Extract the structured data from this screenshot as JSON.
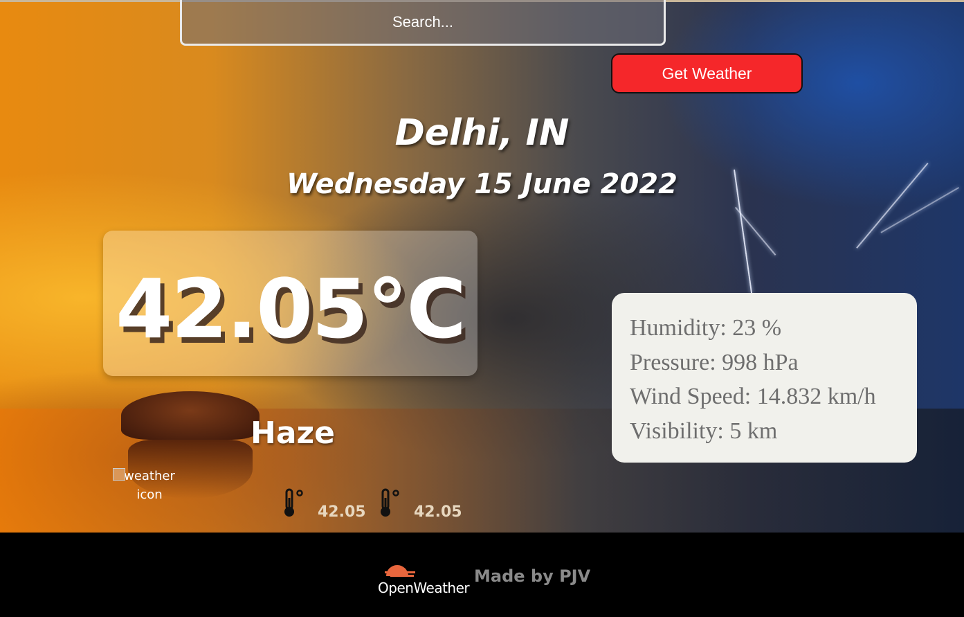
{
  "search": {
    "placeholder": "Search..."
  },
  "actions": {
    "get_weather_label": "Get Weather"
  },
  "location": {
    "city": "Delhi, IN",
    "date": "Wednesday 15 June 2022"
  },
  "current": {
    "temperature": "42.05°C",
    "condition": "Haze",
    "icon_alt": "weather icon"
  },
  "min_max": [
    {
      "icon": "thermometer-icon",
      "value": "42.05"
    },
    {
      "icon": "thermometer-icon",
      "value": "42.05"
    }
  ],
  "details": {
    "humidity": "Humidity: 23 %",
    "pressure": "Pressure: 998 hPa",
    "wind": "Wind Speed: 14.832 km/h",
    "visibility": "Visibility: 5 km"
  },
  "footer": {
    "brand": "OpenWeather",
    "credit": "Made by PJV"
  },
  "colors": {
    "button": "#f5272a",
    "details_bg": "#f1f1ec",
    "footer_bg": "#000000",
    "brand_logo": "#e8663d"
  }
}
